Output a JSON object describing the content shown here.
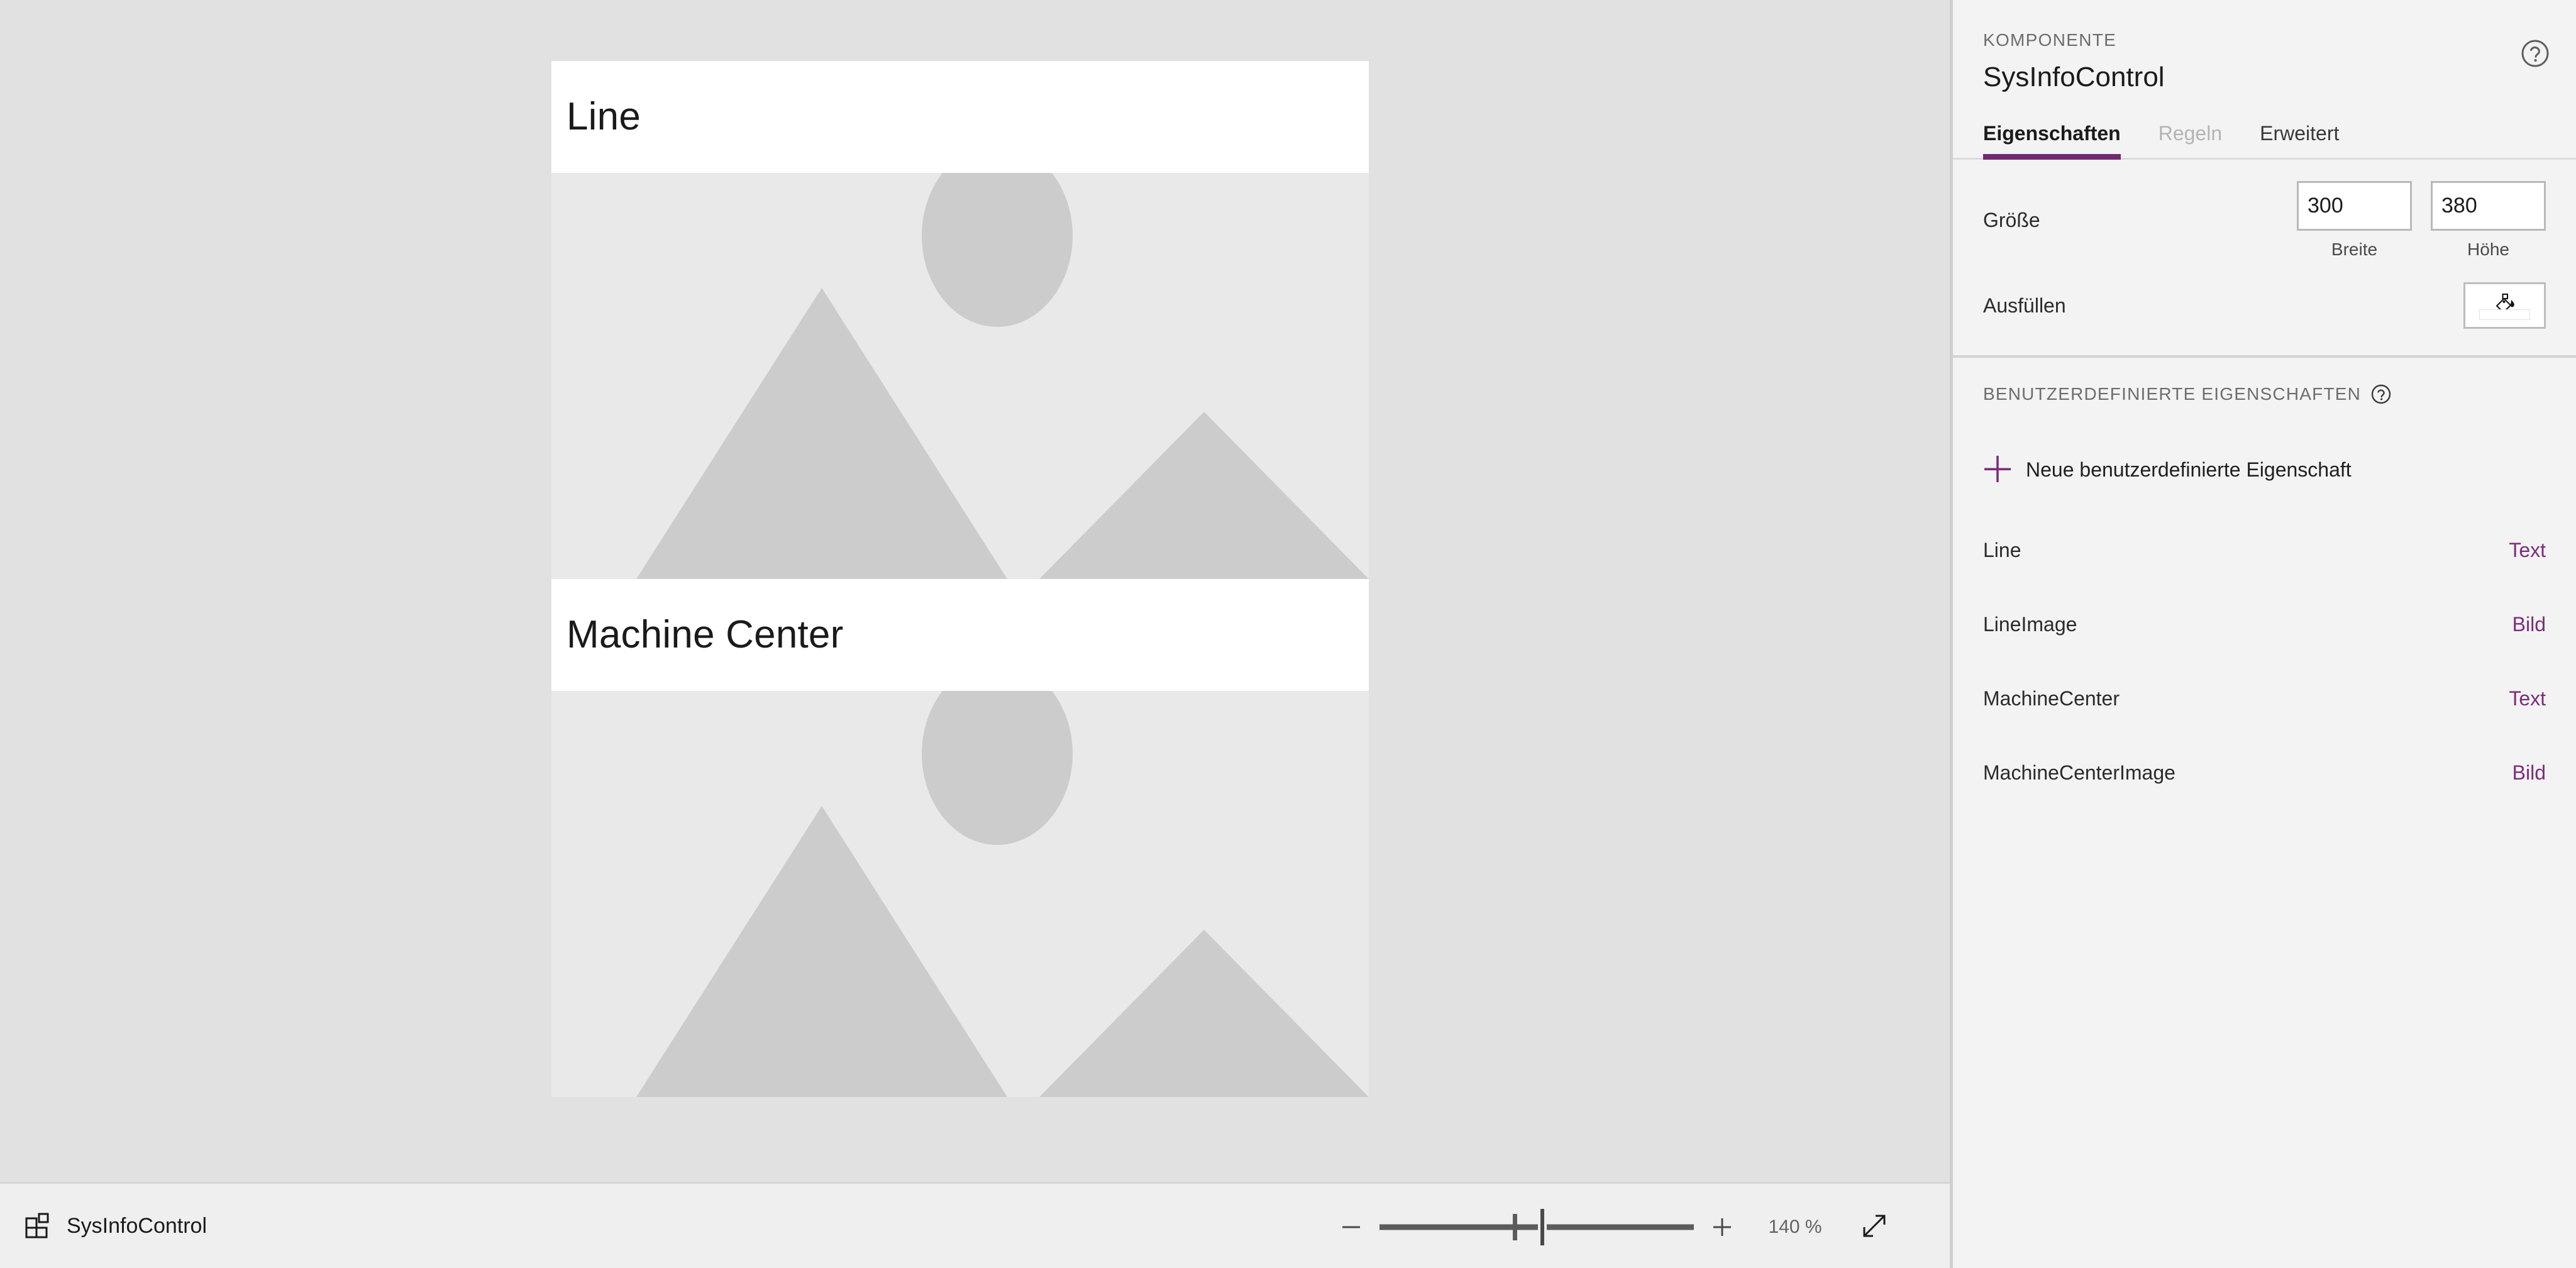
{
  "app": {
    "accent_color": "#702a70",
    "link_color": "#7b2d7b",
    "canvas_bg": "#e1e1e1",
    "panel_bg": "#f3f3f3"
  },
  "canvas": {
    "cards": [
      {
        "title": "Line",
        "image_placeholder_icon": "image-placeholder-mountains"
      },
      {
        "title": "Machine Center",
        "image_placeholder_icon": "image-placeholder-mountains"
      }
    ]
  },
  "statusbar": {
    "component_icon": "component-blocks-icon",
    "component_name": "SysInfoControl",
    "zoom": {
      "decrease_icon": "minus-icon",
      "increase_icon": "plus-icon",
      "level": "140 %",
      "fit_icon": "fit-to-screen-icon"
    }
  },
  "panel": {
    "eyebrow": "KOMPONENTE",
    "title": "SysInfoControl",
    "help_icon": "help-circle-icon",
    "tabs": [
      {
        "label": "Eigenschaften",
        "state": "active"
      },
      {
        "label": "Regeln",
        "state": "disabled"
      },
      {
        "label": "Erweitert",
        "state": "normal"
      }
    ],
    "size": {
      "label": "Größe",
      "width_value": "300",
      "width_caption": "Breite",
      "height_value": "380",
      "height_caption": "Höhe"
    },
    "fill": {
      "label": "Ausfüllen",
      "button_icon": "paint-bucket-icon",
      "swatch_color": "#ffffff"
    },
    "custom": {
      "heading": "BENUTZERDEFINIERTE EIGENSCHAFTEN",
      "help_icon": "help-circle-icon",
      "add_icon": "plus-icon",
      "add_label": "Neue benutzerdefinierte Eigenschaft",
      "properties": [
        {
          "name": "Line",
          "type": "Text"
        },
        {
          "name": "LineImage",
          "type": "Bild"
        },
        {
          "name": "MachineCenter",
          "type": "Text"
        },
        {
          "name": "MachineCenterImage",
          "type": "Bild"
        }
      ]
    }
  }
}
